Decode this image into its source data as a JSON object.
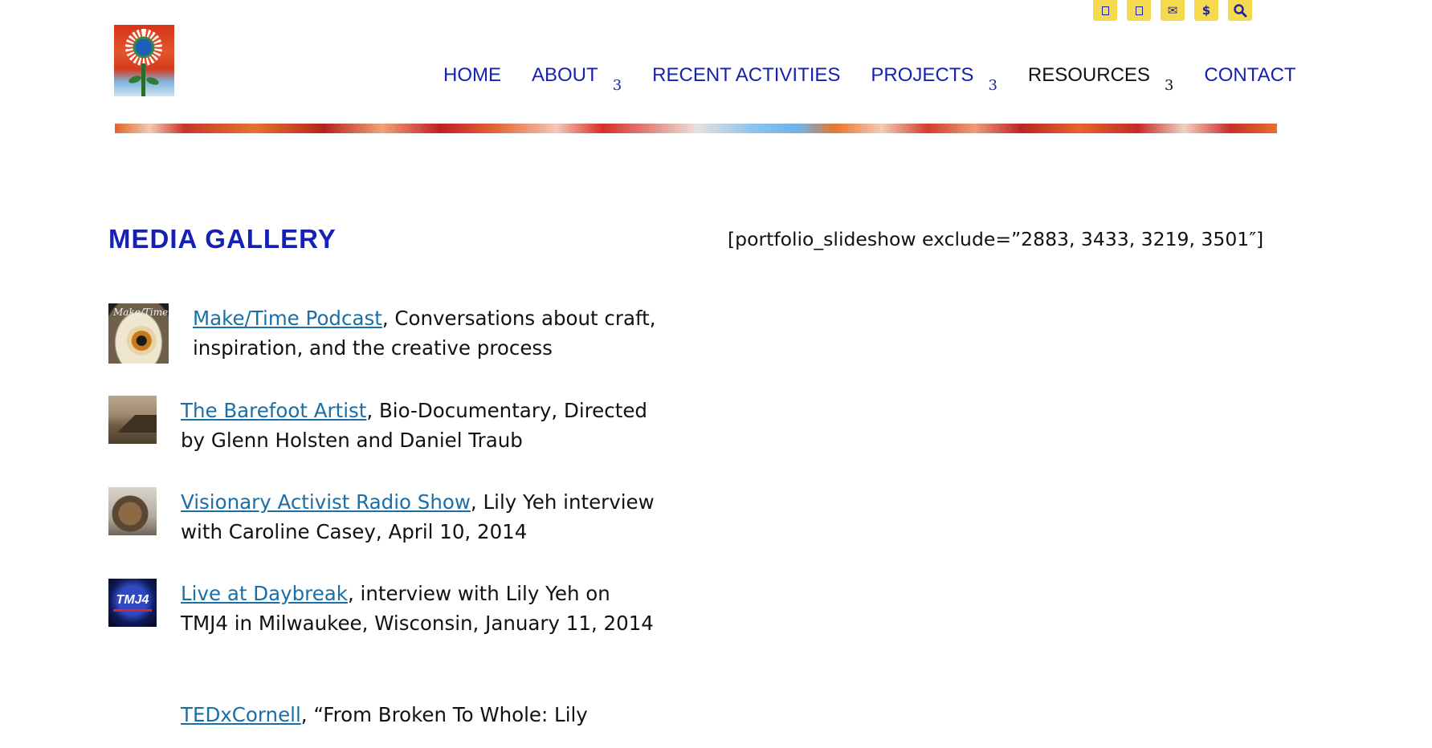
{
  "top_icons": [
    {
      "icon": "facebook-icon",
      "glyph": ""
    },
    {
      "icon": "instagram-icon",
      "glyph": ""
    },
    {
      "icon": "envelope-icon",
      "glyph": "✉"
    },
    {
      "icon": "dollar-icon",
      "glyph": "$"
    },
    {
      "icon": "search-icon",
      "glyph": "🔍"
    }
  ],
  "nav": {
    "home": "HOME",
    "about": "ABOUT",
    "about_caret": "3",
    "recent": "RECENT ACTIVITIES",
    "projects": "PROJECTS",
    "projects_caret": "3",
    "resources": "RESOURCES",
    "resources_caret": "3",
    "contact": "CONTACT"
  },
  "colors": {
    "accent_blue": "#1521b5",
    "link_blue": "#1a6fa8",
    "icon_yellow": "#f5d94e"
  },
  "main": {
    "title": "MEDIA GALLERY",
    "shortcode": "[portfolio_slideshow exclude=”2883, 3433, 3219, 3501″]",
    "items": [
      {
        "thumb_caption": "Make/Time",
        "link": "Make/Time Podcast",
        "text": ", Conversations about craft, inspiration, and the creative process"
      },
      {
        "link": "The Barefoot Artist",
        "text": ", Bio-Documentary, Directed by Glenn Holsten and Daniel Traub"
      },
      {
        "link": "Visionary Activist Radio Show",
        "text": ", Lily Yeh interview with Caroline Casey, April 10, 2014"
      },
      {
        "thumb_caption": "TMJ4",
        "link": "Live at Daybreak",
        "text": ", interview with Lily Yeh on TMJ4 in Milwaukee, Wisconsin, January 11, 2014"
      },
      {
        "link": "TEDxCornell",
        "text": ", “From Broken To Whole: Lily"
      }
    ]
  }
}
